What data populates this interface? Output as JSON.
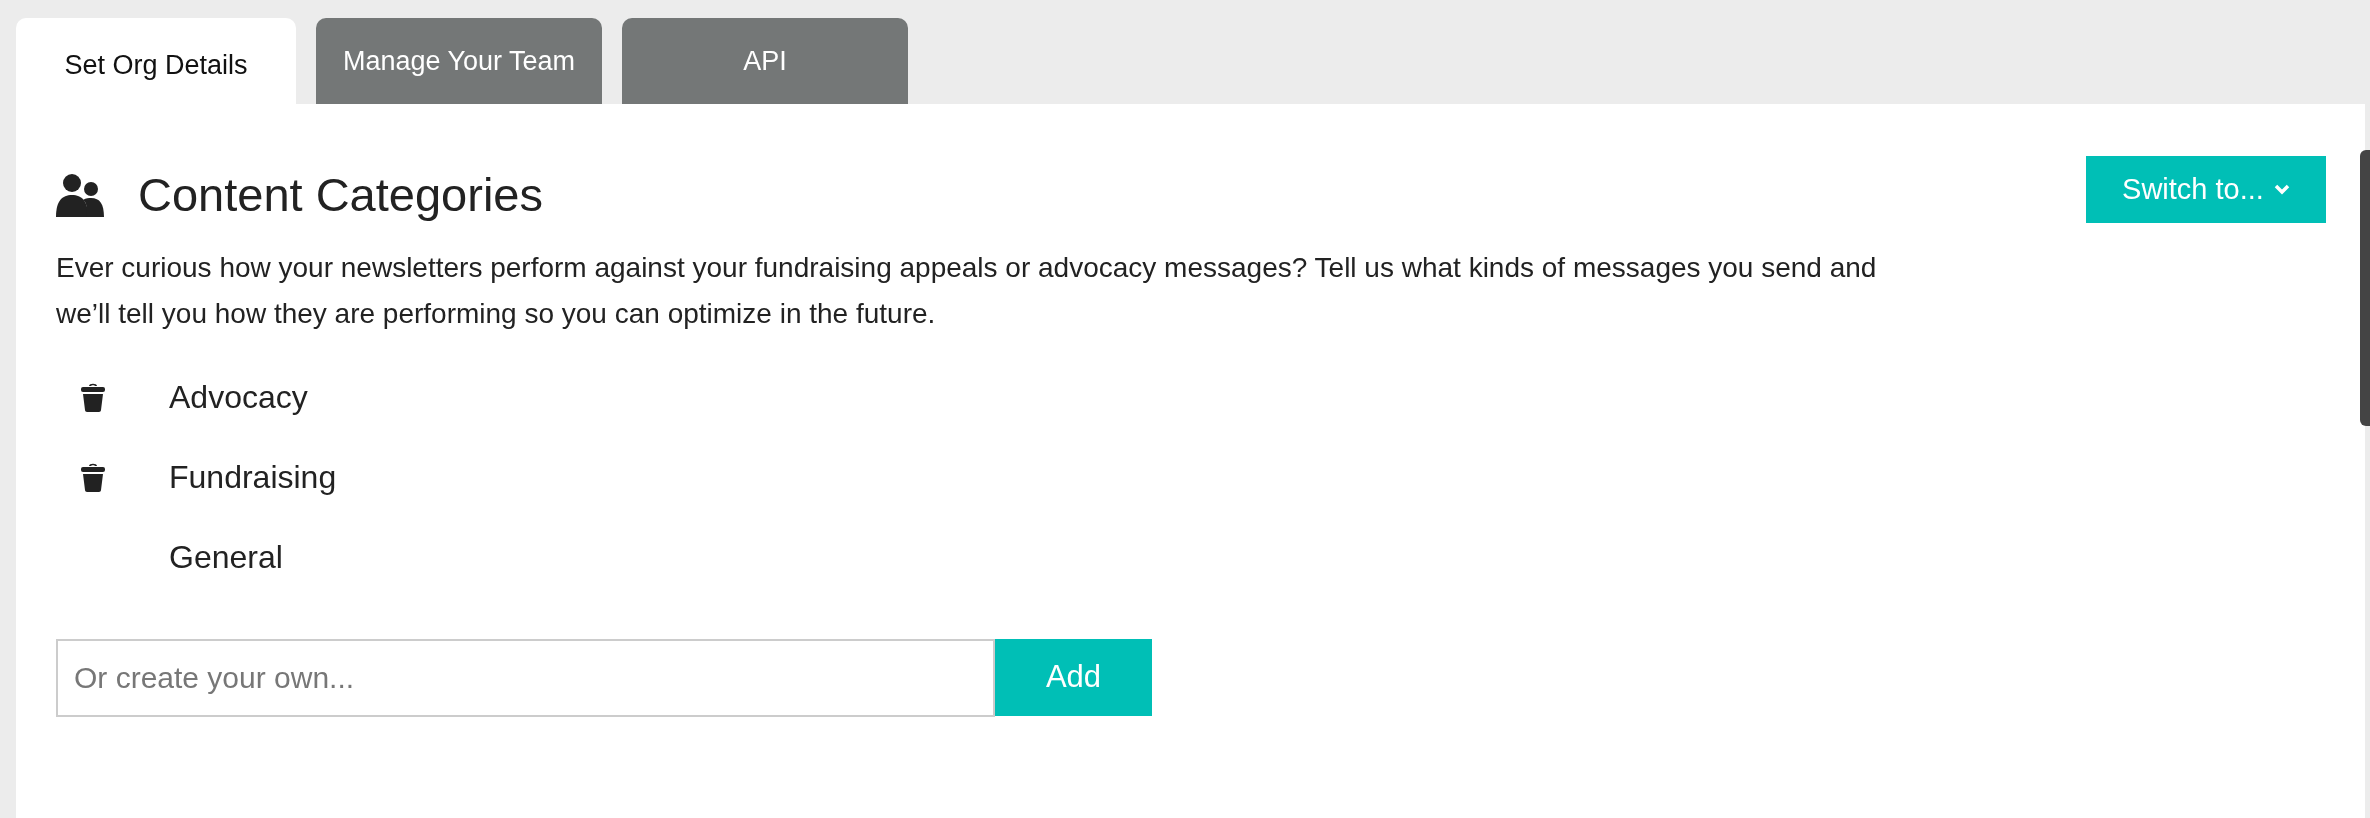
{
  "tabs": [
    {
      "label": "Set Org Details",
      "selected": true
    },
    {
      "label": "Manage Your Team",
      "selected": false
    },
    {
      "label": "API",
      "selected": false
    }
  ],
  "section": {
    "title": "Content Categories",
    "switch_button": "Switch to...",
    "description": "Ever curious how your newsletters perform against your fundraising appeals or advocacy messages? Tell us what kinds of messages you send and we’ll tell you how they are performing so you can optimize in the future."
  },
  "categories": [
    {
      "name": "Advocacy",
      "deletable": true
    },
    {
      "name": "Fundraising",
      "deletable": true
    },
    {
      "name": "General",
      "deletable": false
    }
  ],
  "new_category": {
    "placeholder": "Or create your own...",
    "button": "Add"
  }
}
